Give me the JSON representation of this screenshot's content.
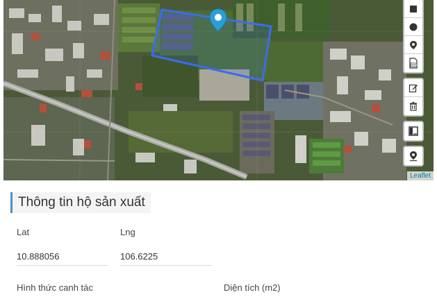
{
  "map": {
    "attribution": "Leaflet",
    "colors": {
      "polygon": "#3a6df0",
      "marker": "#2a9fd6"
    },
    "toolbar": [
      {
        "name": "draw-polyline-icon"
      },
      {
        "name": "draw-circle-icon"
      },
      {
        "name": "draw-marker-icon"
      },
      {
        "name": "import-kml-icon"
      },
      {
        "name": "edit-layers-icon"
      },
      {
        "name": "delete-layers-icon"
      },
      {
        "name": "fullscreen-icon"
      },
      {
        "name": "locate-icon"
      }
    ]
  },
  "form": {
    "title": "Thông tin hộ sản xuất",
    "lat_label": "Lat",
    "lat_value": "10.888056",
    "lng_label": "Lng",
    "lng_value": "106.6225",
    "farming_label": "Hình thức canh tác",
    "area_label": "Diện tích (m2)",
    "accent_color": "#4a90c8"
  }
}
